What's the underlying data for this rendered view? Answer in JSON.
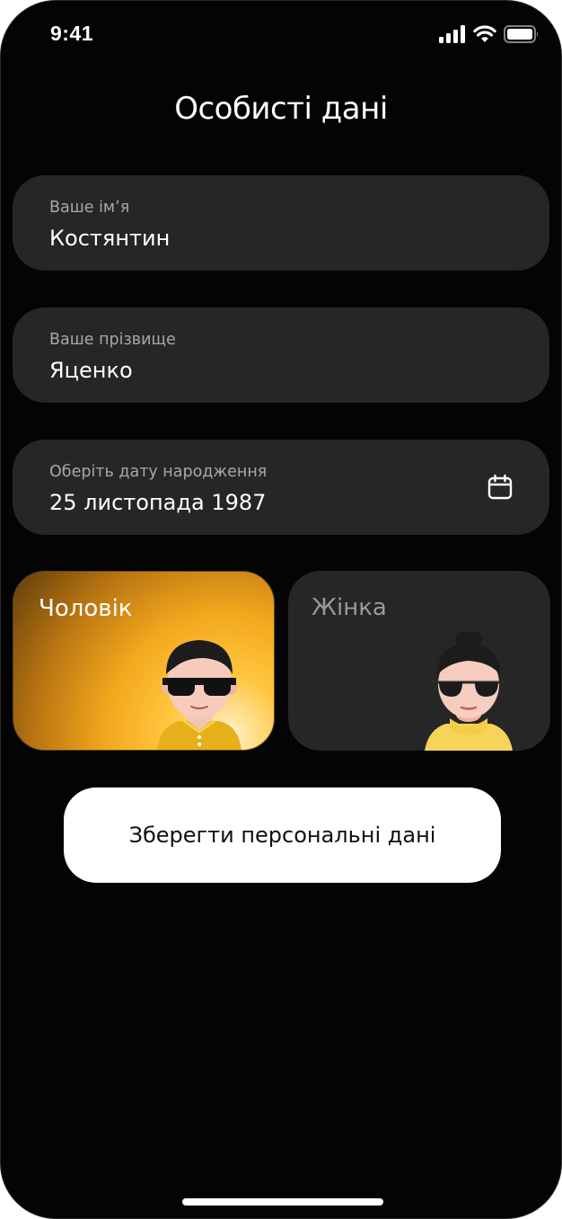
{
  "status_bar": {
    "time": "9:41",
    "icons": [
      "cellular-signal-icon",
      "wifi-icon",
      "battery-icon"
    ]
  },
  "page": {
    "title": "Особисті дані"
  },
  "form": {
    "first_name": {
      "label": "Ваше ім’я",
      "value": "Костянтин"
    },
    "last_name": {
      "label": "Ваше прізвище",
      "value": "Яценко"
    },
    "birth_date": {
      "label": "Оберіть дату народження",
      "value": "25 листопада 1987",
      "icon": "calendar-icon"
    }
  },
  "gender": {
    "selected": "male",
    "male_label": "Чоловік",
    "female_label": "Жінка",
    "selected_color": "#F5A623"
  },
  "actions": {
    "save_label": "Зберегти персональні дані"
  }
}
